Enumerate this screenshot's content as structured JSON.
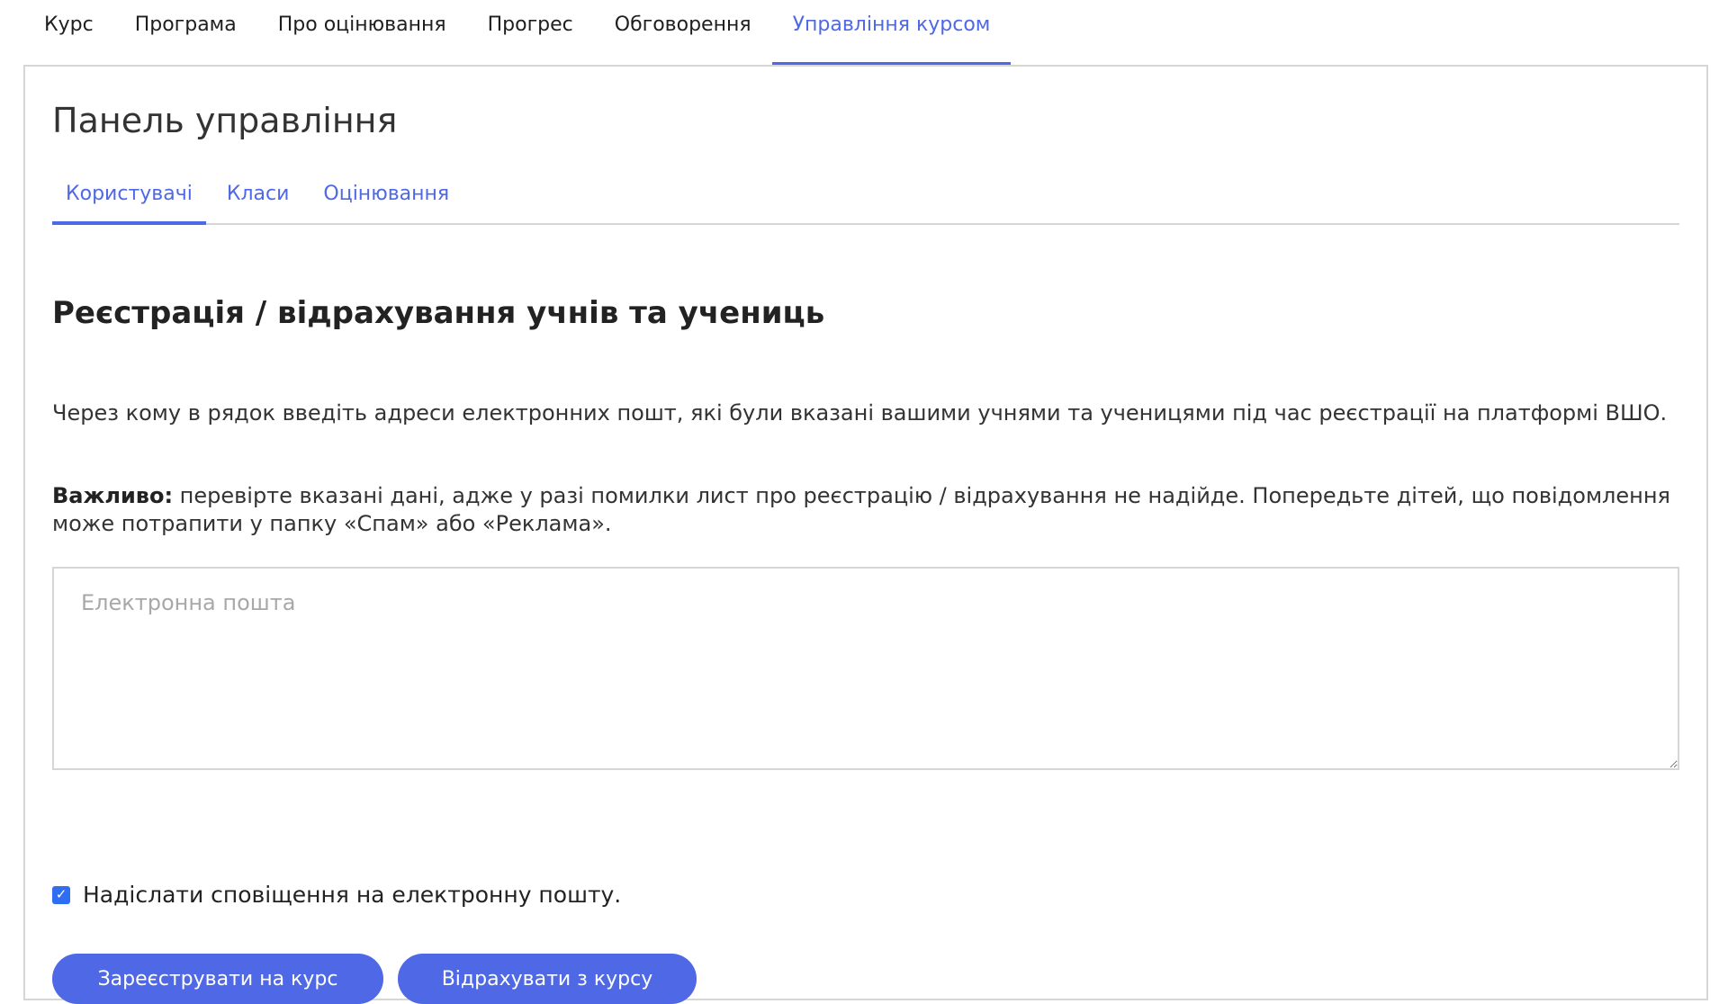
{
  "top_nav": {
    "tabs": [
      {
        "label": "Курс"
      },
      {
        "label": "Програма"
      },
      {
        "label": "Про оцінювання"
      },
      {
        "label": "Прогрес"
      },
      {
        "label": "Обговорення"
      },
      {
        "label": "Управління курсом"
      }
    ],
    "active_index": 5
  },
  "panel": {
    "title": "Панель управління",
    "sub_tabs": [
      {
        "label": "Користувачі"
      },
      {
        "label": "Класи"
      },
      {
        "label": "Оцінювання"
      }
    ],
    "active_sub_tab": 0
  },
  "enrollment": {
    "title": "Реєстрація / відрахування учнів та учениць",
    "instructions": "Через кому в рядок введіть адреси електронних пошт, які були вказані вашими учнями та ученицями під час реєстрації на платформі ВШО.",
    "important_label": "Важливо:",
    "important_text": " перевірте вказані дані, адже у разі помилки лист про реєстрацію / відрахування не надійде. Попередьте дітей, що повідомлення може потрапити у папку «Спам» або «Реклама».",
    "email_input": {
      "value": "",
      "placeholder": "Електронна пошта"
    },
    "notify": {
      "label": "Надіслати сповіщення на електронну пошту.",
      "checked": true
    },
    "enroll_button": "Зареєструвати на курс",
    "unenroll_button": "Відрахувати з курсу"
  },
  "colors": {
    "accent": "#4f68e5",
    "checkbox": "#2f6ef2",
    "border": "#d6d6d6"
  }
}
